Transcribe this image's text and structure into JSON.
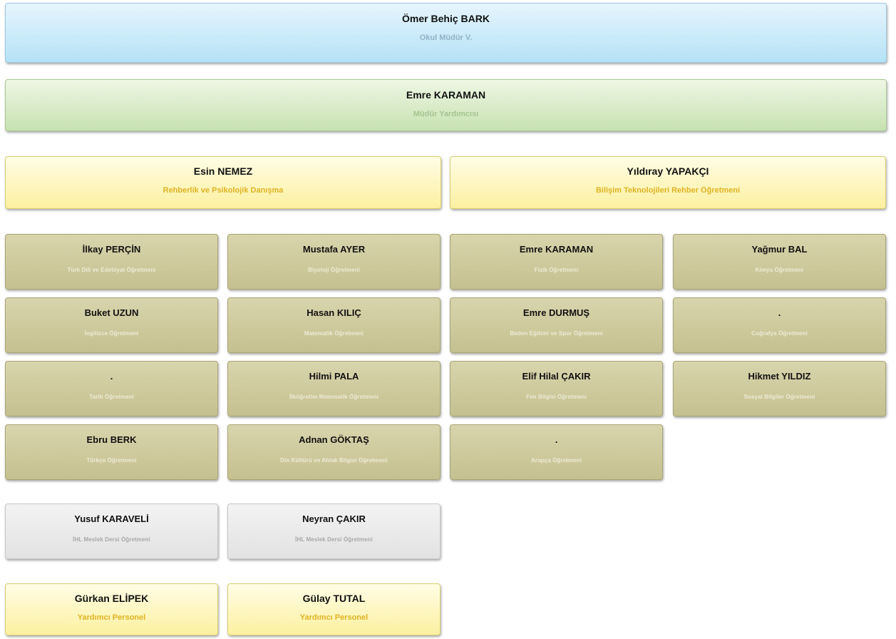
{
  "principal": {
    "name": "Ömer Behiç BARK",
    "role": "Okul Müdür V."
  },
  "vice_principal": {
    "name": "Emre KARAMAN",
    "role": "Müdür Yardımcısı"
  },
  "guidance": [
    {
      "name": "Esin NEMEZ",
      "role": "Rehberlik ve Psikolojik Danışma"
    },
    {
      "name": "Yıldıray YAPAKÇI",
      "role": "Bilişim Teknolojileri Rehber Öğretmeni"
    }
  ],
  "teachers": [
    {
      "name": "İlkay PERÇİN",
      "role": "Türk Dili ve Edebiyat Öğretmeni"
    },
    {
      "name": "Mustafa AYER",
      "role": "Biyoloji Öğretmeni"
    },
    {
      "name": "Emre KARAMAN",
      "role": "Fizik Öğretmeni"
    },
    {
      "name": "Yağmur BAL",
      "role": "Kimya Öğretmeni"
    },
    {
      "name": "Buket UZUN",
      "role": "İngilizce Öğretmeni"
    },
    {
      "name": "Hasan KILIÇ",
      "role": "Matematik Öğretmeni"
    },
    {
      "name": "Emre DURMUŞ",
      "role": "Beden Eğitimi ve Spor Öğretmeni"
    },
    {
      "name": ".",
      "role": "Coğrafya Öğretmeni"
    },
    {
      "name": ".",
      "role": "Tarih Öğretmeni"
    },
    {
      "name": "Hilmi PALA",
      "role": "İlköğretim Matematik Öğretmeni"
    },
    {
      "name": "Elif Hilal ÇAKIR",
      "role": "Fen Bilgisi Öğretmeni"
    },
    {
      "name": "Hikmet YILDIZ",
      "role": "Sosyal Bilgiler Öğretmeni"
    },
    {
      "name": "Ebru BERK",
      "role": "Türkçe Öğretmeni"
    },
    {
      "name": "Adnan GÖKTAŞ",
      "role": "Din Kültürü ve Ahlak Bilgisi Öğretmeni"
    },
    {
      "name": ".",
      "role": "Arapça Öğretmeni"
    }
  ],
  "vocational": [
    {
      "name": "Yusuf KARAVELİ",
      "role": "İHL Meslek Dersi Öğretmeni"
    },
    {
      "name": "Neyran ÇAKIR",
      "role": "İHL Meslek Dersi Öğretmeni"
    }
  ],
  "support_staff": [
    {
      "name": "Gürkan ELİPEK",
      "role": "Yardımcı Personel"
    },
    {
      "name": "Gülay TUTAL",
      "role": "Yardımcı Personel"
    }
  ]
}
